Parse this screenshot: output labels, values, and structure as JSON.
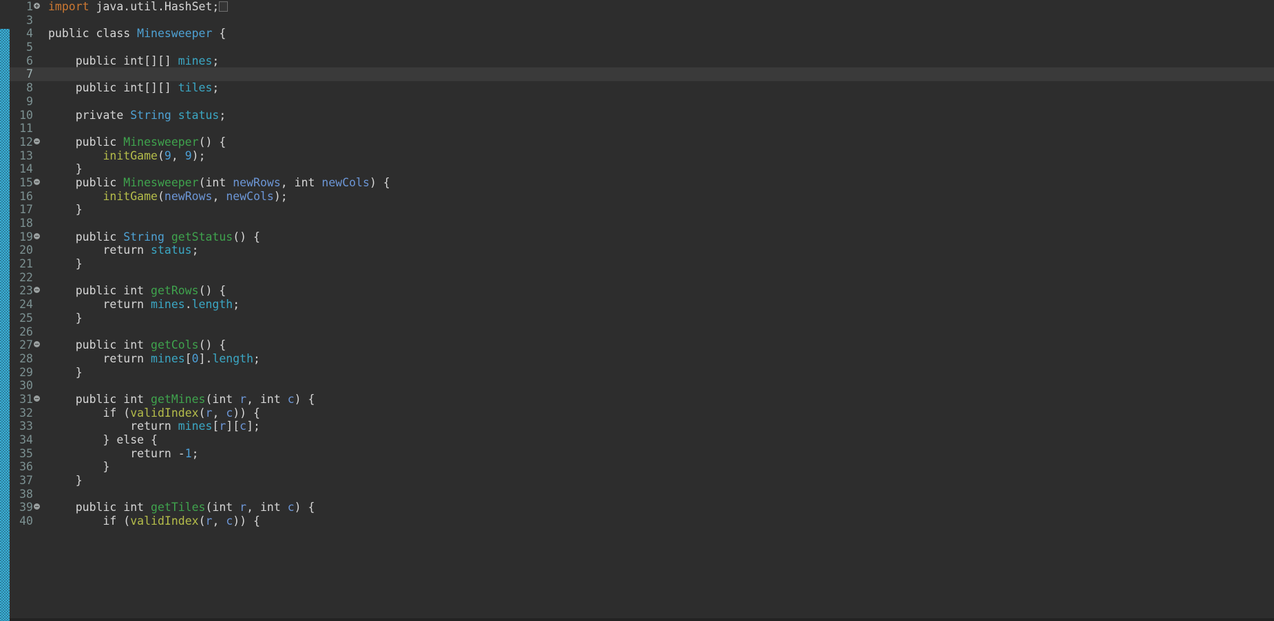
{
  "editor": {
    "language": "Java",
    "file_class_name": "Minesweeper",
    "background_color": "#2d2d2d",
    "current_line_background": "#3a3a3a",
    "gutter_color": "#7c9192",
    "left_strip_color": "#39b0d6",
    "current_line_number": 7,
    "first_visible_line": 1,
    "last_visible_line": 40,
    "fold_placeholder": "...",
    "icons": {
      "fold_collapsed": "fold-expand-plus-icon",
      "fold_expanded": "fold-collapse-minus-icon"
    }
  },
  "lines": [
    {
      "num": "1",
      "marker": "plus",
      "current": false,
      "tokens": [
        {
          "t": "import",
          "c": "t-import"
        },
        {
          "t": " java.util.HashSet;",
          "c": "t-plain"
        },
        {
          "t": "...",
          "c": "fold-box"
        }
      ]
    },
    {
      "num": "3",
      "marker": "",
      "current": false,
      "tokens": []
    },
    {
      "num": "4",
      "marker": "",
      "current": false,
      "tokens": [
        {
          "t": "public class ",
          "c": "t-kw"
        },
        {
          "t": "Minesweeper",
          "c": "t-class"
        },
        {
          "t": " {",
          "c": "t-plain"
        }
      ]
    },
    {
      "num": "5",
      "marker": "",
      "current": false,
      "tokens": []
    },
    {
      "num": "6",
      "marker": "",
      "current": false,
      "tokens": [
        {
          "t": "    public int[][] ",
          "c": "t-kw"
        },
        {
          "t": "mines",
          "c": "t-field"
        },
        {
          "t": ";",
          "c": "t-plain"
        }
      ]
    },
    {
      "num": "7",
      "marker": "",
      "current": true,
      "tokens": []
    },
    {
      "num": "8",
      "marker": "",
      "current": false,
      "tokens": [
        {
          "t": "    public int[][] ",
          "c": "t-kw"
        },
        {
          "t": "tiles",
          "c": "t-field"
        },
        {
          "t": ";",
          "c": "t-plain"
        }
      ]
    },
    {
      "num": "9",
      "marker": "",
      "current": false,
      "tokens": []
    },
    {
      "num": "10",
      "marker": "",
      "current": false,
      "tokens": [
        {
          "t": "    private ",
          "c": "t-kw"
        },
        {
          "t": "String",
          "c": "t-type"
        },
        {
          "t": " ",
          "c": "t-plain"
        },
        {
          "t": "status",
          "c": "t-field"
        },
        {
          "t": ";",
          "c": "t-plain"
        }
      ]
    },
    {
      "num": "11",
      "marker": "",
      "current": false,
      "tokens": []
    },
    {
      "num": "12",
      "marker": "dot",
      "current": false,
      "tokens": [
        {
          "t": "    public ",
          "c": "t-kw"
        },
        {
          "t": "Minesweeper",
          "c": "t-method"
        },
        {
          "t": "() {",
          "c": "t-plain"
        }
      ]
    },
    {
      "num": "13",
      "marker": "",
      "current": false,
      "tokens": [
        {
          "t": "        ",
          "c": "t-plain"
        },
        {
          "t": "initGame",
          "c": "t-call"
        },
        {
          "t": "(",
          "c": "t-plain"
        },
        {
          "t": "9",
          "c": "t-num"
        },
        {
          "t": ", ",
          "c": "t-plain"
        },
        {
          "t": "9",
          "c": "t-num"
        },
        {
          "t": ");",
          "c": "t-plain"
        }
      ]
    },
    {
      "num": "14",
      "marker": "",
      "current": false,
      "tokens": [
        {
          "t": "    }",
          "c": "t-plain"
        }
      ]
    },
    {
      "num": "15",
      "marker": "dot",
      "current": false,
      "tokens": [
        {
          "t": "    public ",
          "c": "t-kw"
        },
        {
          "t": "Minesweeper",
          "c": "t-method"
        },
        {
          "t": "(int ",
          "c": "t-plain"
        },
        {
          "t": "newRows",
          "c": "t-param"
        },
        {
          "t": ", int ",
          "c": "t-plain"
        },
        {
          "t": "newCols",
          "c": "t-param"
        },
        {
          "t": ") {",
          "c": "t-plain"
        }
      ]
    },
    {
      "num": "16",
      "marker": "",
      "current": false,
      "tokens": [
        {
          "t": "        ",
          "c": "t-plain"
        },
        {
          "t": "initGame",
          "c": "t-call"
        },
        {
          "t": "(",
          "c": "t-plain"
        },
        {
          "t": "newRows",
          "c": "t-param"
        },
        {
          "t": ", ",
          "c": "t-plain"
        },
        {
          "t": "newCols",
          "c": "t-param"
        },
        {
          "t": ");",
          "c": "t-plain"
        }
      ]
    },
    {
      "num": "17",
      "marker": "",
      "current": false,
      "tokens": [
        {
          "t": "    }",
          "c": "t-plain"
        }
      ]
    },
    {
      "num": "18",
      "marker": "",
      "current": false,
      "tokens": []
    },
    {
      "num": "19",
      "marker": "dot",
      "current": false,
      "tokens": [
        {
          "t": "    public ",
          "c": "t-kw"
        },
        {
          "t": "String",
          "c": "t-type"
        },
        {
          "t": " ",
          "c": "t-plain"
        },
        {
          "t": "getStatus",
          "c": "t-method"
        },
        {
          "t": "() {",
          "c": "t-plain"
        }
      ]
    },
    {
      "num": "20",
      "marker": "",
      "current": false,
      "tokens": [
        {
          "t": "        return ",
          "c": "t-kw"
        },
        {
          "t": "status",
          "c": "t-field"
        },
        {
          "t": ";",
          "c": "t-plain"
        }
      ]
    },
    {
      "num": "21",
      "marker": "",
      "current": false,
      "tokens": [
        {
          "t": "    }",
          "c": "t-plain"
        }
      ]
    },
    {
      "num": "22",
      "marker": "",
      "current": false,
      "tokens": []
    },
    {
      "num": "23",
      "marker": "dot",
      "current": false,
      "tokens": [
        {
          "t": "    public int ",
          "c": "t-kw"
        },
        {
          "t": "getRows",
          "c": "t-method"
        },
        {
          "t": "() {",
          "c": "t-plain"
        }
      ]
    },
    {
      "num": "24",
      "marker": "",
      "current": false,
      "tokens": [
        {
          "t": "        return ",
          "c": "t-kw"
        },
        {
          "t": "mines",
          "c": "t-field"
        },
        {
          "t": ".",
          "c": "t-plain"
        },
        {
          "t": "length",
          "c": "t-field"
        },
        {
          "t": ";",
          "c": "t-plain"
        }
      ]
    },
    {
      "num": "25",
      "marker": "",
      "current": false,
      "tokens": [
        {
          "t": "    }",
          "c": "t-plain"
        }
      ]
    },
    {
      "num": "26",
      "marker": "",
      "current": false,
      "tokens": []
    },
    {
      "num": "27",
      "marker": "dot",
      "current": false,
      "tokens": [
        {
          "t": "    public int ",
          "c": "t-kw"
        },
        {
          "t": "getCols",
          "c": "t-method"
        },
        {
          "t": "() {",
          "c": "t-plain"
        }
      ]
    },
    {
      "num": "28",
      "marker": "",
      "current": false,
      "tokens": [
        {
          "t": "        return ",
          "c": "t-kw"
        },
        {
          "t": "mines",
          "c": "t-field"
        },
        {
          "t": "[",
          "c": "t-plain"
        },
        {
          "t": "0",
          "c": "t-num"
        },
        {
          "t": "].",
          "c": "t-plain"
        },
        {
          "t": "length",
          "c": "t-field"
        },
        {
          "t": ";",
          "c": "t-plain"
        }
      ]
    },
    {
      "num": "29",
      "marker": "",
      "current": false,
      "tokens": [
        {
          "t": "    }",
          "c": "t-plain"
        }
      ]
    },
    {
      "num": "30",
      "marker": "",
      "current": false,
      "tokens": []
    },
    {
      "num": "31",
      "marker": "dot",
      "current": false,
      "tokens": [
        {
          "t": "    public int ",
          "c": "t-kw"
        },
        {
          "t": "getMines",
          "c": "t-method"
        },
        {
          "t": "(int ",
          "c": "t-plain"
        },
        {
          "t": "r",
          "c": "t-param"
        },
        {
          "t": ", int ",
          "c": "t-plain"
        },
        {
          "t": "c",
          "c": "t-param"
        },
        {
          "t": ") {",
          "c": "t-plain"
        }
      ]
    },
    {
      "num": "32",
      "marker": "",
      "current": false,
      "tokens": [
        {
          "t": "        if (",
          "c": "t-plain"
        },
        {
          "t": "validIndex",
          "c": "t-call"
        },
        {
          "t": "(",
          "c": "t-plain"
        },
        {
          "t": "r",
          "c": "t-param"
        },
        {
          "t": ", ",
          "c": "t-plain"
        },
        {
          "t": "c",
          "c": "t-param"
        },
        {
          "t": ")) {",
          "c": "t-plain"
        }
      ]
    },
    {
      "num": "33",
      "marker": "",
      "current": false,
      "tokens": [
        {
          "t": "            return ",
          "c": "t-kw"
        },
        {
          "t": "mines",
          "c": "t-field"
        },
        {
          "t": "[",
          "c": "t-plain"
        },
        {
          "t": "r",
          "c": "t-param"
        },
        {
          "t": "][",
          "c": "t-plain"
        },
        {
          "t": "c",
          "c": "t-param"
        },
        {
          "t": "];",
          "c": "t-plain"
        }
      ]
    },
    {
      "num": "34",
      "marker": "",
      "current": false,
      "tokens": [
        {
          "t": "        } else {",
          "c": "t-plain"
        }
      ]
    },
    {
      "num": "35",
      "marker": "",
      "current": false,
      "tokens": [
        {
          "t": "            return -",
          "c": "t-kw"
        },
        {
          "t": "1",
          "c": "t-num"
        },
        {
          "t": ";",
          "c": "t-plain"
        }
      ]
    },
    {
      "num": "36",
      "marker": "",
      "current": false,
      "tokens": [
        {
          "t": "        }",
          "c": "t-plain"
        }
      ]
    },
    {
      "num": "37",
      "marker": "",
      "current": false,
      "tokens": [
        {
          "t": "    }",
          "c": "t-plain"
        }
      ]
    },
    {
      "num": "38",
      "marker": "",
      "current": false,
      "tokens": []
    },
    {
      "num": "39",
      "marker": "dot",
      "current": false,
      "tokens": [
        {
          "t": "    public int ",
          "c": "t-kw"
        },
        {
          "t": "getTiles",
          "c": "t-method"
        },
        {
          "t": "(int ",
          "c": "t-plain"
        },
        {
          "t": "r",
          "c": "t-param"
        },
        {
          "t": ", int ",
          "c": "t-plain"
        },
        {
          "t": "c",
          "c": "t-param"
        },
        {
          "t": ") {",
          "c": "t-plain"
        }
      ]
    },
    {
      "num": "40",
      "marker": "",
      "current": false,
      "tokens": [
        {
          "t": "        if (",
          "c": "t-plain"
        },
        {
          "t": "validIndex",
          "c": "t-call"
        },
        {
          "t": "(",
          "c": "t-plain"
        },
        {
          "t": "r",
          "c": "t-param"
        },
        {
          "t": ", ",
          "c": "t-plain"
        },
        {
          "t": "c",
          "c": "t-param"
        },
        {
          "t": ")) {",
          "c": "t-plain"
        }
      ]
    }
  ]
}
